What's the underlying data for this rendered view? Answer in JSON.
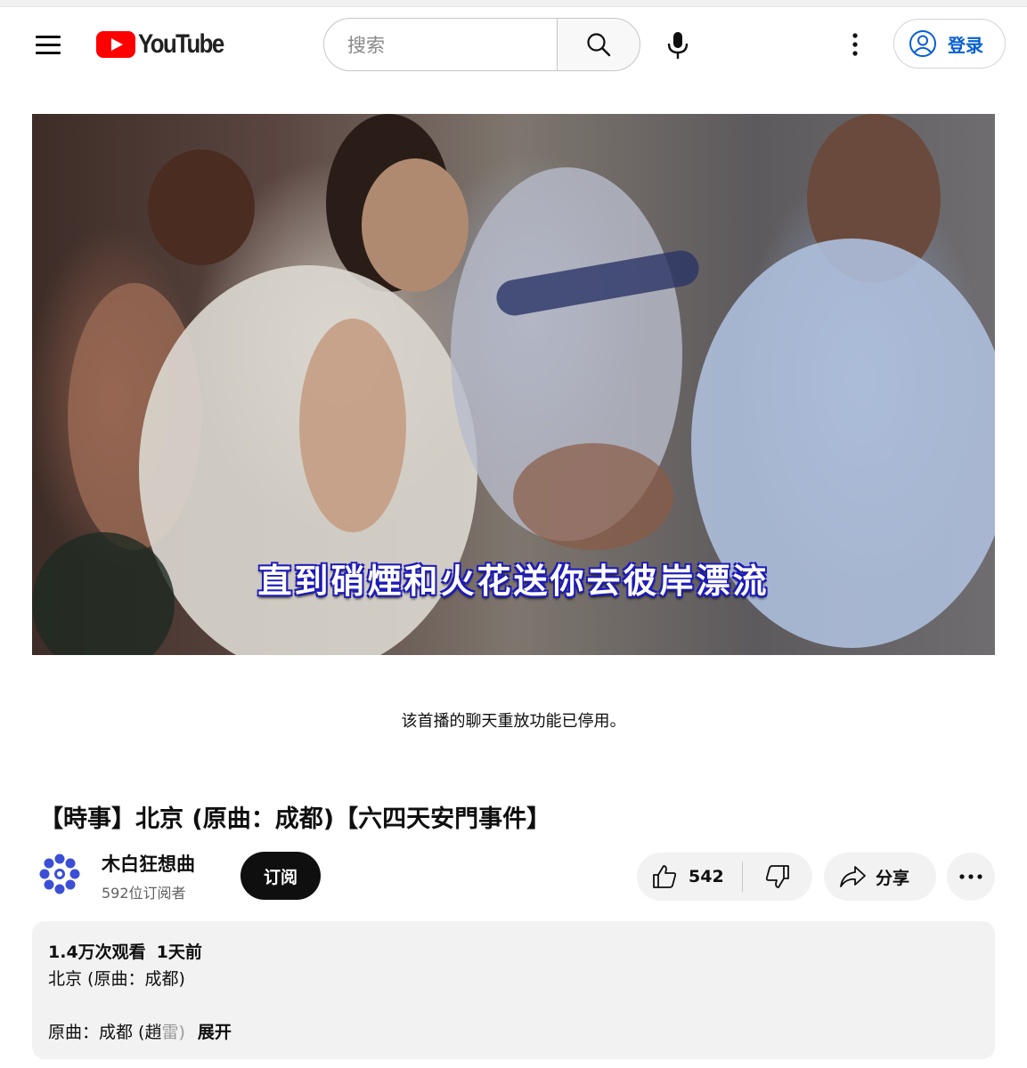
{
  "header": {
    "logo_text": "YouTube",
    "search_placeholder": "搜索",
    "signin_label": "登录"
  },
  "player": {
    "subtitle": "直到硝煙和火花送你去彼岸漂流"
  },
  "chat": {
    "replay_disabled": "该首播的聊天重放功能已停用。"
  },
  "video": {
    "title": "【時事】北京 (原曲：成都)【六四天安門事件】",
    "channel_name": "木白狂想曲",
    "subscriber_count": "592位订阅者",
    "subscribe_label": "订阅",
    "like_count": "542",
    "share_label": "分享"
  },
  "description": {
    "views": "1.4万次观看",
    "date": "1天前",
    "line1": "北京 (原曲：成都)",
    "line2": "原曲：成都 (趙",
    "line2_faded": "雷)",
    "expand_label": "展开"
  },
  "colors": {
    "brand_red": "#ff0000",
    "link_blue": "#065fd4",
    "chip_bg": "#f2f2f2",
    "avatar_blue": "#3b4fd6"
  }
}
